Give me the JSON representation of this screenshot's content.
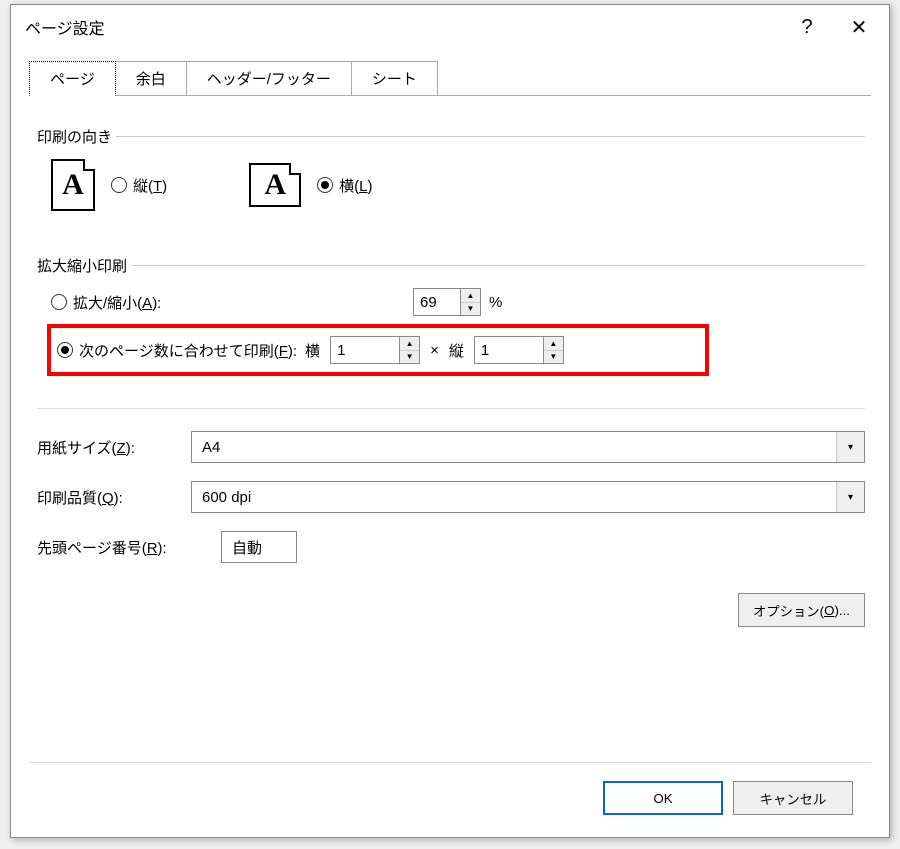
{
  "dialog": {
    "title": "ページ設定",
    "help_label": "?",
    "close_label": "✕"
  },
  "tabs": {
    "page": "ページ",
    "margins": "余白",
    "headerfooter": "ヘッダー/フッター",
    "sheet": "シート"
  },
  "orientation": {
    "group_label": "印刷の向き",
    "icon_letter": "A",
    "portrait_label_pre": "縦(",
    "portrait_key": "T",
    "portrait_label_post": ")",
    "landscape_label_pre": "横(",
    "landscape_key": "L",
    "landscape_label_post": ")"
  },
  "scaling": {
    "group_label": "拡大縮小印刷",
    "adjust_label_pre": "拡大/縮小(",
    "adjust_key": "A",
    "adjust_label_post": "):",
    "adjust_value": "69",
    "adjust_unit": "%",
    "fit_label_pre": "次のページ数に合わせて印刷(",
    "fit_key": "F",
    "fit_label_post": "):",
    "fit_wide_label": "横",
    "fit_wide_value": "1",
    "fit_times": "×",
    "fit_tall_label": "縦",
    "fit_tall_value": "1"
  },
  "paper": {
    "size_label_pre": "用紙サイズ(",
    "size_key": "Z",
    "size_label_post": "):",
    "size_value": "A4",
    "quality_label_pre": "印刷品質(",
    "quality_key": "Q",
    "quality_label_post": "):",
    "quality_value": "600 dpi",
    "firstpage_label_pre": "先頭ページ番号(",
    "firstpage_key": "R",
    "firstpage_label_post": "):",
    "firstpage_value": "自動"
  },
  "buttons": {
    "options_pre": "オプション(",
    "options_key": "O",
    "options_post": ")...",
    "ok": "OK",
    "cancel": "キャンセル"
  }
}
